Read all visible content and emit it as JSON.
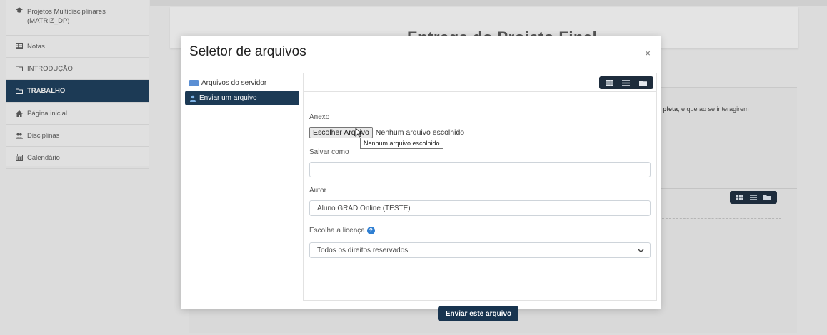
{
  "background": {
    "page_title": "Entrega do Projeto Final",
    "card_text_bold": "pleta",
    "card_text_rest": ", e que ao se interagirem"
  },
  "sidebar": {
    "items": [
      {
        "label": "Projetos Multidisciplinares (MATRIZ_DP)",
        "icon": "graduation-cap-icon"
      },
      {
        "label": "Notas",
        "icon": "table-icon"
      },
      {
        "label": "INTRODUÇÃO",
        "icon": "folder-icon"
      },
      {
        "label": "TRABALHO",
        "icon": "folder-icon",
        "active": true
      },
      {
        "label": "Página inicial",
        "icon": "home-icon"
      },
      {
        "label": "Disciplinas",
        "icon": "users-icon"
      },
      {
        "label": "Calendário",
        "icon": "calendar-icon"
      }
    ]
  },
  "modal": {
    "title": "Seletor de arquivos",
    "close": "×",
    "nav": [
      {
        "label": "Arquivos do servidor",
        "icon": "server-files-icon"
      },
      {
        "label": "Enviar um arquivo",
        "icon": "upload-user-icon",
        "active": true
      }
    ],
    "form": {
      "attachment_label": "Anexo",
      "choose_file_button": "Escolher Arquivo",
      "no_file_text": "Nenhum arquivo escolhido",
      "tooltip": "Nenhum arquivo escolhido",
      "save_as_label": "Salvar como",
      "save_as_value": "",
      "author_label": "Autor",
      "author_value": "Aluno GRAD Online (TESTE)",
      "license_label": "Escolha a licença",
      "license_value": "Todos os direitos reservados",
      "submit_button": "Enviar este arquivo"
    }
  },
  "colors": {
    "primary": "#1c3a55",
    "toolbar": "#1d2c3c",
    "help": "#2f7fd2"
  }
}
